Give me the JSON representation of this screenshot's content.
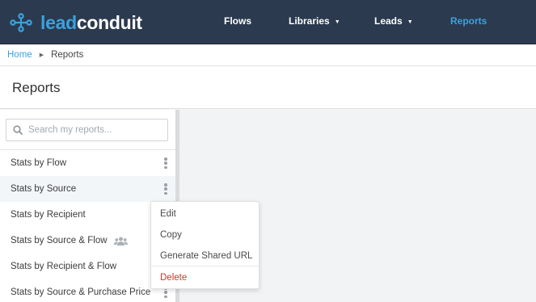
{
  "app": {
    "logo_lead": "lead",
    "logo_conduit": "conduit"
  },
  "nav": {
    "items": [
      {
        "label": "Flows",
        "has_caret": false,
        "active": false
      },
      {
        "label": "Libraries",
        "has_caret": true,
        "active": false
      },
      {
        "label": "Leads",
        "has_caret": true,
        "active": false
      },
      {
        "label": "Reports",
        "has_caret": false,
        "active": true
      }
    ],
    "caret_glyph": "▼"
  },
  "breadcrumb": {
    "home": "Home",
    "separator": "▶",
    "current": "Reports"
  },
  "page": {
    "title": "Reports"
  },
  "search": {
    "placeholder": "Search my reports...",
    "value": ""
  },
  "reports": [
    {
      "label": "Stats by Flow",
      "shared": false,
      "selected": false
    },
    {
      "label": "Stats by Source",
      "shared": false,
      "selected": true
    },
    {
      "label": "Stats by Recipient",
      "shared": false,
      "selected": false
    },
    {
      "label": "Stats by Source & Flow",
      "shared": true,
      "selected": false
    },
    {
      "label": "Stats by Recipient & Flow",
      "shared": false,
      "selected": false
    },
    {
      "label": "Stats by Source & Purchase Price",
      "shared": false,
      "selected": false
    }
  ],
  "context_menu": {
    "items": [
      {
        "label": "Edit"
      },
      {
        "label": "Copy"
      },
      {
        "label": "Generate Shared URL"
      },
      {
        "label": "Delete"
      }
    ]
  },
  "colors": {
    "nav_bg": "#2b3a4f",
    "accent": "#3aa2dd",
    "danger": "#c43b2c",
    "main_bg": "#f2f3f5"
  },
  "icons": {
    "logo": "network-nodes-icon",
    "search": "search-icon",
    "kebab": "vertical-ellipsis-icon",
    "shared": "people-icon"
  }
}
